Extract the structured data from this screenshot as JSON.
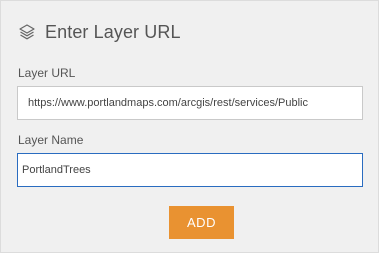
{
  "header": {
    "icon": "layers-icon",
    "title": "Enter Layer URL"
  },
  "form": {
    "url_label": "Layer URL",
    "url_value": "https://www.portlandmaps.com/arcgis/rest/services/Public",
    "name_label": "Layer Name",
    "name_value": "PortlandTrees"
  },
  "actions": {
    "add_label": "ADD"
  },
  "colors": {
    "panel_bg": "#f0f0f0",
    "accent_button": "#e99231",
    "focus_border": "#2a6cc0",
    "text": "#555555"
  }
}
